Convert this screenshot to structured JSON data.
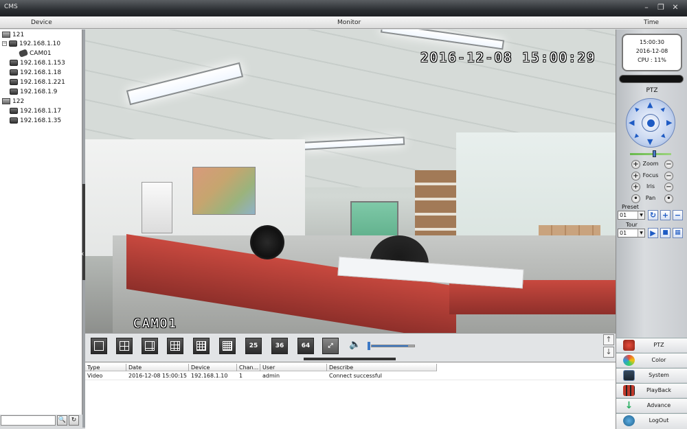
{
  "window": {
    "title": "CMS",
    "controls": [
      "minimize",
      "restore",
      "close"
    ]
  },
  "headers": {
    "device": "Device",
    "monitor": "Monitor",
    "time": "Time"
  },
  "tree": {
    "groups": [
      {
        "name": "121",
        "top": true
      },
      {
        "name": "192.168.1.10",
        "expanded": true
      },
      {
        "name": "CAM01"
      },
      {
        "name": "192.168.1.153"
      },
      {
        "name": "192.168.1.18"
      },
      {
        "name": "192.168.1.221"
      },
      {
        "name": "192.168.1.9"
      },
      {
        "name": "122",
        "top": true
      },
      {
        "name": "192.168.1.17"
      },
      {
        "name": "192.168.1.35"
      }
    ],
    "search_value": ""
  },
  "video": {
    "osd_datetime": "2016-12-08  15:00:29",
    "osd_channel": "CAMO1"
  },
  "layout_buttons": [
    "1",
    "4",
    "6",
    "9",
    "16",
    "16b",
    "25",
    "36",
    "64"
  ],
  "layout_labels": {
    "b25": "25",
    "b36": "36",
    "b64": "64"
  },
  "volume": {
    "level": 0.85
  },
  "log": {
    "columns": [
      "Type",
      "Date",
      "Device",
      "Chan...",
      "User",
      "Describe"
    ],
    "rows": [
      [
        "Video",
        "2016-12-08 15:00:15",
        "192.168.1.10",
        "1",
        "admin",
        "Connect successful"
      ]
    ]
  },
  "clock": {
    "time": "15:00:30",
    "date": "2016-12-08",
    "cpu": "CPU : 11%"
  },
  "ptz": {
    "title": "PTZ",
    "zoom": "Zoom",
    "focus": "Focus",
    "iris": "Iris",
    "pan": "Pan",
    "preset_label": "Preset",
    "preset_value": "01",
    "tour_label": "Tour",
    "tour_value": "01",
    "speed": 0.6
  },
  "menu": [
    {
      "label": "PTZ",
      "icon": "ptz-icon",
      "color": "#c0392b"
    },
    {
      "label": "Color",
      "icon": "color-icon",
      "color": "#e67e22"
    },
    {
      "label": "System",
      "icon": "system-icon",
      "color": "#2c3e50"
    },
    {
      "label": "PlayBack",
      "icon": "playback-icon",
      "color": "#c0392b"
    },
    {
      "label": "Advance",
      "icon": "advance-icon",
      "color": "#27ae60"
    },
    {
      "label": "LogOut",
      "icon": "logout-icon",
      "color": "#2980b9"
    }
  ]
}
